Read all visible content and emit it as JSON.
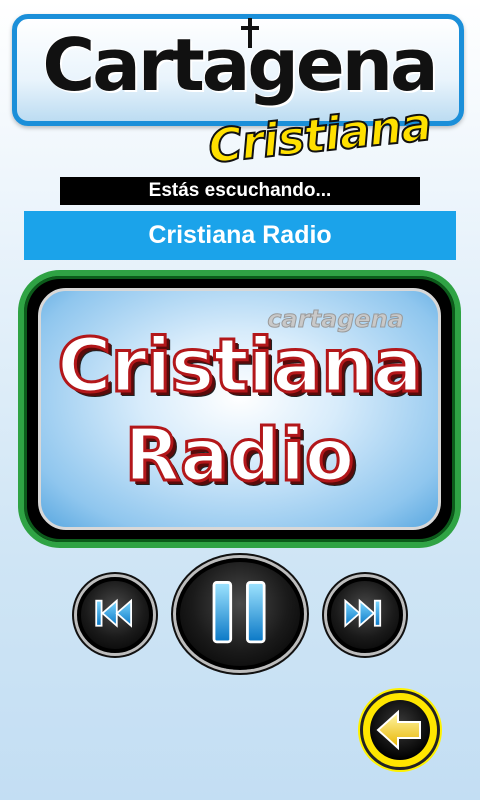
{
  "logo": {
    "title": "Cartagena",
    "subtitle": "Cristiana"
  },
  "now_playing": {
    "label": "Estás escuchando...",
    "station": "Cristiana Radio"
  },
  "artwork": {
    "brand": "cartagena",
    "line1": "Cristiana",
    "line2": "Radio"
  },
  "controls": {
    "prev_icon": "skip-previous-icon",
    "play_icon": "pause-icon",
    "next_icon": "skip-next-icon",
    "back_icon": "back-arrow-icon"
  },
  "colors": {
    "accent_blue": "#1ba3ea",
    "frame_green": "#2fa344",
    "logo_yellow": "#ffe000",
    "art_red": "#b3171a"
  }
}
